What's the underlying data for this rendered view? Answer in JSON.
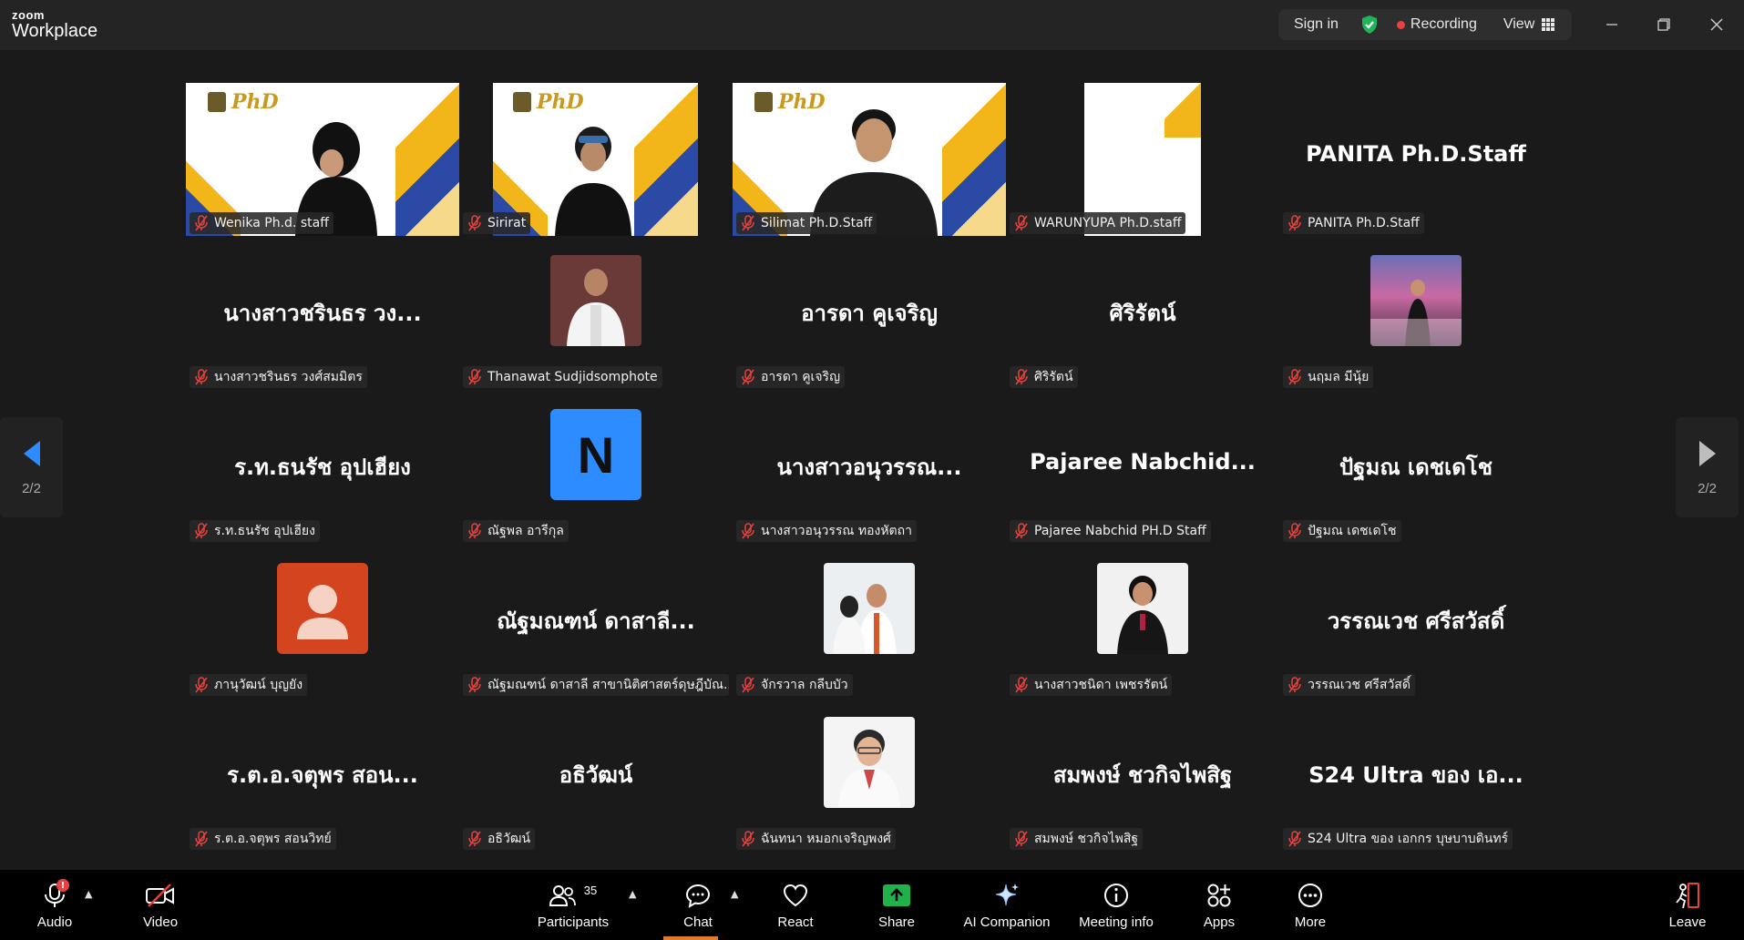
{
  "app": {
    "brand": "zoom",
    "product": "Workplace"
  },
  "title_bar": {
    "sign_in": "Sign in",
    "recording": "Recording",
    "view": "View"
  },
  "pager": {
    "prev_page": "2/2",
    "next_page": "2/2"
  },
  "colors": {
    "accent": "#0b5cff",
    "recording_red": "#e8423f",
    "mic_muted": "#e8423f",
    "share_green": "#21b14b",
    "shield_green": "#1fb45a"
  },
  "tiles": [
    {
      "kind": "video",
      "label": "Wenika Ph.d. staff"
    },
    {
      "kind": "video",
      "label": "Sirirat"
    },
    {
      "kind": "video",
      "label": "Silimat Ph.D.Staff"
    },
    {
      "kind": "video",
      "label": "WARUNYUPA Ph.D.staff"
    },
    {
      "kind": "name",
      "big": "PANITA Ph.D.Staff",
      "label": "PANITA Ph.D.Staff"
    },
    {
      "kind": "name",
      "big": "นางสาวชรินธร วง...",
      "label": "นางสาวชรินธร วงศ์สมมิตร"
    },
    {
      "kind": "photo",
      "label": "Thanawat Sudjidsomphote"
    },
    {
      "kind": "name",
      "big": "อารดา คูเจริญ",
      "label": "อารดา คูเจริญ"
    },
    {
      "kind": "name",
      "big": "ศิริรัตน์",
      "label": "ศิริรัตน์"
    },
    {
      "kind": "photo",
      "label": "นฤมล มีนุ้ย"
    },
    {
      "kind": "name",
      "big": "ร.ท.ธนรัช อุปเฮียง",
      "label": "ร.ท.ธนรัช อุปเฮียง"
    },
    {
      "kind": "letter",
      "letter": "N",
      "label": "ณัฐพล อารีกุล"
    },
    {
      "kind": "name",
      "big": "นางสาวอนุวรรณ...",
      "label": "นางสาวอนุวรรณ ทองหัตถา"
    },
    {
      "kind": "name",
      "big": "Pajaree Nabchid...",
      "label": "Pajaree Nabchid PH.D Staff"
    },
    {
      "kind": "name",
      "big": "ปัฐมณ เดชเดโช",
      "label": "ปัฐมณ เดชเดโช"
    },
    {
      "kind": "default-avatar",
      "label": "ภานุวัฒน์ บุญยัง"
    },
    {
      "kind": "name",
      "big": "ณัฐมณฑน์ ดาสาลี...",
      "label": "ณัฐมณฑน์ ดาสาลี สาขานิติศาสตร์ดุษฎีบัณ..."
    },
    {
      "kind": "photo",
      "label": "จักรวาล กลีบบัว"
    },
    {
      "kind": "photo",
      "label": "นางสาวชนิดา เพชรรัตน์"
    },
    {
      "kind": "name",
      "big": "วรรณเวช ศรีสวัสดิ์",
      "label": "วรรณเวช ศรีสวัสดิ์"
    },
    {
      "kind": "name",
      "big": "ร.ต.อ.จตุพร สอน...",
      "label": "ร.ต.อ.จตุพร สอนวิทย์"
    },
    {
      "kind": "name",
      "big": "อธิวัฒน์",
      "label": "อธิวัฒน์"
    },
    {
      "kind": "photo",
      "label": "ฉันทนา หมอกเจริญพงศ์"
    },
    {
      "kind": "name",
      "big": "สมพงษ์ ชวกิจไพสิฐ",
      "label": "สมพงษ์ ชวกิจไพสิฐ"
    },
    {
      "kind": "name",
      "big": "S24 Ultra ของ เอ...",
      "label": "S24 Ultra ของ เอกกร บุษบาบดินทร์"
    }
  ],
  "toolbar": {
    "audio": "Audio",
    "video": "Video",
    "participants": "Participants",
    "participants_count": "35",
    "chat": "Chat",
    "react": "React",
    "share": "Share",
    "ai_companion": "AI Companion",
    "meeting_info": "Meeting info",
    "apps": "Apps",
    "more": "More",
    "leave": "Leave"
  }
}
